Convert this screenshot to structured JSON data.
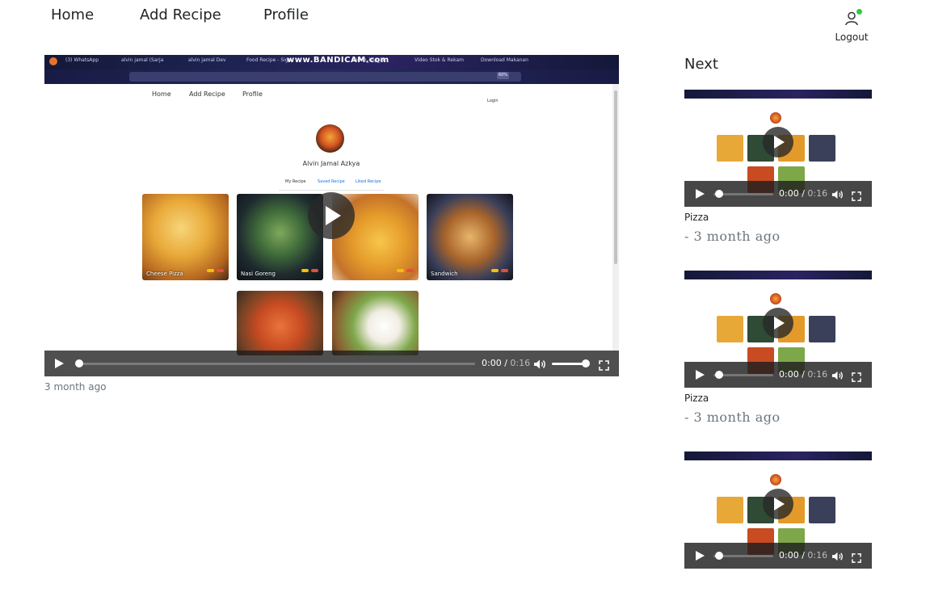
{
  "nav": {
    "items": [
      "Home",
      "Add Recipe",
      "Profile"
    ],
    "logout_label": "Logout"
  },
  "main_video": {
    "recording": {
      "watermark": "www.BANDICAM.com",
      "tabs": [
        "(3) WhatsApp",
        "alvin jamal (Sarja",
        "alvin jamal Dev",
        "Food Recipe - Sign",
        "video_klip_id",
        "Video Stok & Rekam",
        "Download Makanan"
      ],
      "zoom": "60%",
      "page_nav": [
        "Home",
        "Add Recipe",
        "Profile"
      ],
      "page_login": "Login",
      "profile_name": "Alvin Jamal Azkya",
      "profile_tabs": [
        "My Recipe",
        "Saved Recipe",
        "Liked Recipe"
      ],
      "recipes": [
        "Cheese Pizza",
        "Nasi Goreng",
        "",
        "Sandwich"
      ]
    },
    "current_time": "0:00",
    "duration": "0:16",
    "progress": 0.0,
    "volume": 1.0,
    "timestamp": "3 month ago"
  },
  "next": {
    "title": "Next",
    "items": [
      {
        "title": "Pizza",
        "time": "- 3 month ago",
        "current_time": "0:00",
        "duration": "0:16"
      },
      {
        "title": "Pizza",
        "time": "- 3 month ago",
        "current_time": "0:00",
        "duration": "0:16"
      },
      {
        "title": "",
        "time": "",
        "current_time": "0:00",
        "duration": "0:16"
      }
    ]
  },
  "colors": {
    "online_indicator": "#2ecc40",
    "control_bar": "#1e1e1e",
    "accent_link": "#1a73e8"
  }
}
